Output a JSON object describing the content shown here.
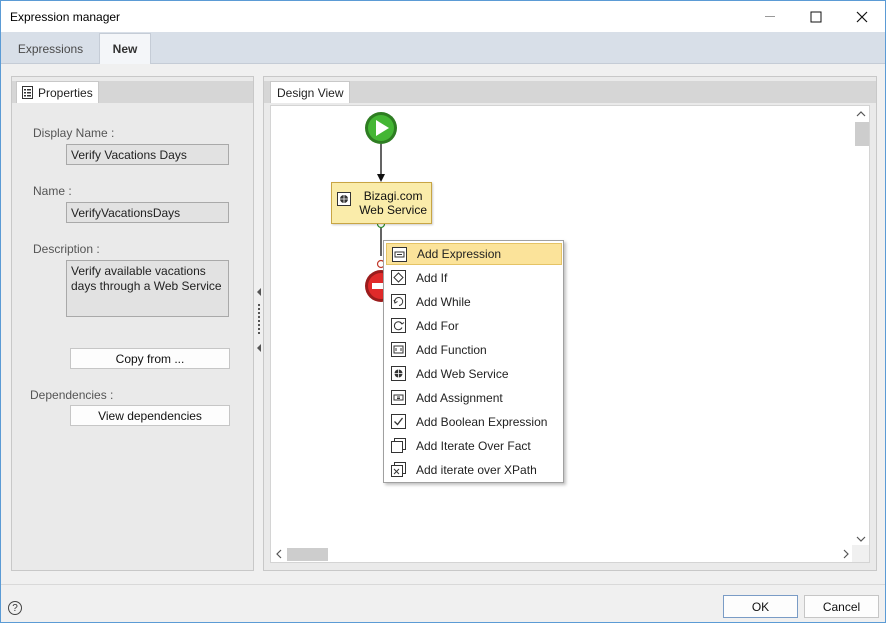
{
  "window": {
    "title": "Expression manager"
  },
  "tabs": [
    {
      "label": "Expressions",
      "active": false
    },
    {
      "label": "New",
      "active": true
    }
  ],
  "properties": {
    "tab_label": "Properties",
    "display_name_label": "Display Name :",
    "display_name_value": "Verify Vacations Days",
    "name_label": "Name :",
    "name_value": "VerifyVacationsDays",
    "description_label": "Description :",
    "description_value": "Verify available vacations days through a Web Service",
    "copy_from_label": "Copy from ...",
    "dependencies_label": "Dependencies :",
    "view_dependencies_label": "View dependencies"
  },
  "design_view": {
    "tab_label": "Design View",
    "task_line1": "Bizagi.com",
    "task_line2": "Web Service"
  },
  "context_menu": {
    "items": [
      {
        "label": "Add Expression",
        "icon": "expression-icon",
        "highlighted": true
      },
      {
        "label": "Add If",
        "icon": "if-icon"
      },
      {
        "label": "Add While",
        "icon": "while-icon"
      },
      {
        "label": "Add For",
        "icon": "for-icon"
      },
      {
        "label": "Add Function",
        "icon": "function-icon"
      },
      {
        "label": "Add Web Service",
        "icon": "web-service-icon"
      },
      {
        "label": "Add Assignment",
        "icon": "assignment-icon"
      },
      {
        "label": "Add Boolean Expression",
        "icon": "boolean-icon"
      },
      {
        "label": "Add Iterate Over Fact",
        "icon": "iterate-fact-icon"
      },
      {
        "label": "Add iterate over XPath",
        "icon": "iterate-xpath-icon"
      }
    ]
  },
  "footer": {
    "help": "?",
    "ok_label": "OK",
    "cancel_label": "Cancel"
  },
  "colors": {
    "accent_border": "#5b9bd5",
    "start_event": "#3daf2c",
    "end_event": "#d9262a",
    "task_fill": "#faecaa",
    "menu_highlight": "#fbe39a"
  }
}
